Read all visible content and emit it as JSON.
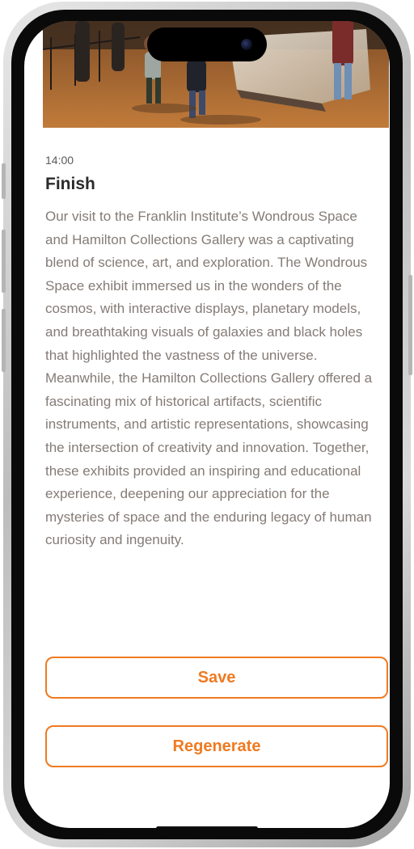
{
  "entry": {
    "time": "14:00",
    "title": "Finish",
    "description": "Our visit to the Franklin Institute’s Wondrous Space and Hamilton Collections Gallery was a captivating blend of science, art, and exploration. The Wondrous Space exhibit immersed us in the wonders of the cosmos, with interactive displays, planetary models, and breathtaking visuals of galaxies and black holes that highlighted the vastness of the universe. Meanwhile, the Hamilton Collections Gallery offered a fascinating mix of historical artifacts, scientific instruments, and artistic representations, showcasing the intersection of creativity and innovation. Together, these exhibits provided an inspiring and educational experience, deepening our appreciation for the mysteries of space and the enduring legacy of human curiosity and ingenuity."
  },
  "actions": {
    "save_label": "Save",
    "regenerate_label": "Regenerate"
  },
  "colors": {
    "accent": "#f07a20",
    "body_text": "#847b76",
    "title_text": "#2b2b2b"
  }
}
